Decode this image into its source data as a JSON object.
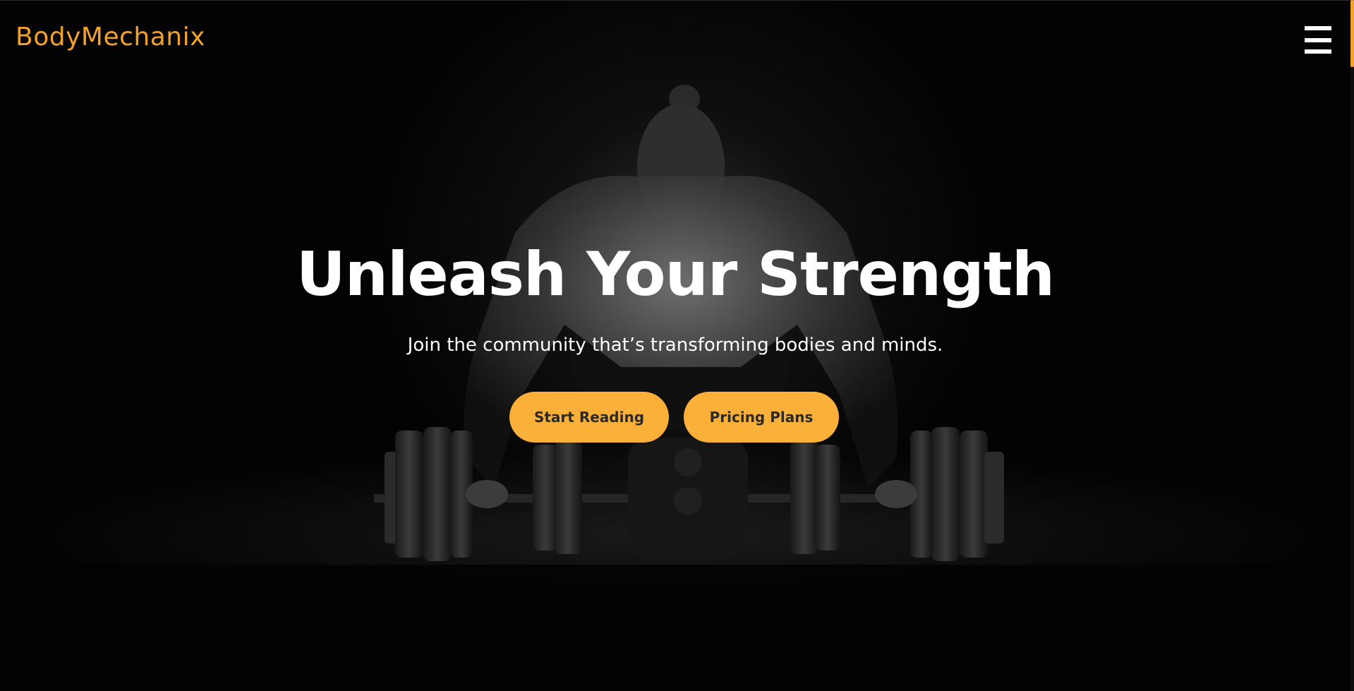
{
  "header": {
    "logo_text": "BodyMechanix",
    "menu_icon": "hamburger-menu-icon"
  },
  "hero": {
    "title": "Unleash Your Strength",
    "subtitle": "Join the community that’s transforming bodies and minds.",
    "buttons": [
      {
        "label": "Start Reading"
      },
      {
        "label": "Pricing Plans"
      }
    ],
    "background": "athlete-with-barbell-photo"
  },
  "colors": {
    "accent": "#f2a22a",
    "button": "#fbb03a",
    "background": "#000000",
    "text": "#ffffff"
  }
}
